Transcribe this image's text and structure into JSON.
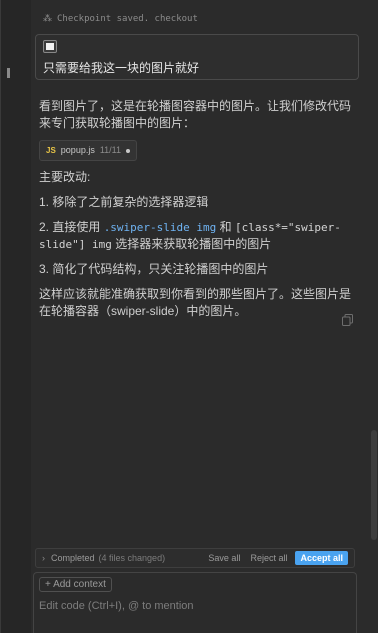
{
  "checkpoint": {
    "text": "Checkpoint saved. checkout"
  },
  "user_message": {
    "text": "只需要给我这一块的图片就好"
  },
  "assistant": {
    "intro": "看到图片了，这是在轮播图容器中的图片。让我们修改代码来专门获取轮播图中的图片：",
    "file_chip": {
      "tag": "JS",
      "name": "popup.js",
      "lines": "11/11"
    },
    "changes_heading": "主要改动:",
    "change1": "1. 移除了之前复杂的选择器逻辑",
    "change2_prefix": "2. 直接使用 ",
    "change2_code1": ".swiper-slide img",
    "change2_mid": " 和 ",
    "change2_code2": "[class*=\"swiper-slide\"] img",
    "change2_suffix": " 选择器来获取轮播图中的图片",
    "change3": "3. 简化了代码结构，只关注轮播图中的图片",
    "conclusion": "这样应该就能准确获取到你看到的那些图片了。这些图片是在轮播容器（swiper-slide）中的图片。"
  },
  "status_bar": {
    "chevron": "›",
    "completed": "Completed",
    "files_changed": "(4 files changed)",
    "save_all": "Save all",
    "reject_all": "Reject all",
    "accept_all": "Accept all"
  },
  "composer": {
    "add_context": "+ Add context",
    "placeholder": "Edit code (Ctrl+I), @ to mention"
  },
  "colors": {
    "accent": "#4aa3f0",
    "code_highlight": "#6fb3f2",
    "js_tag": "#e8c547"
  }
}
